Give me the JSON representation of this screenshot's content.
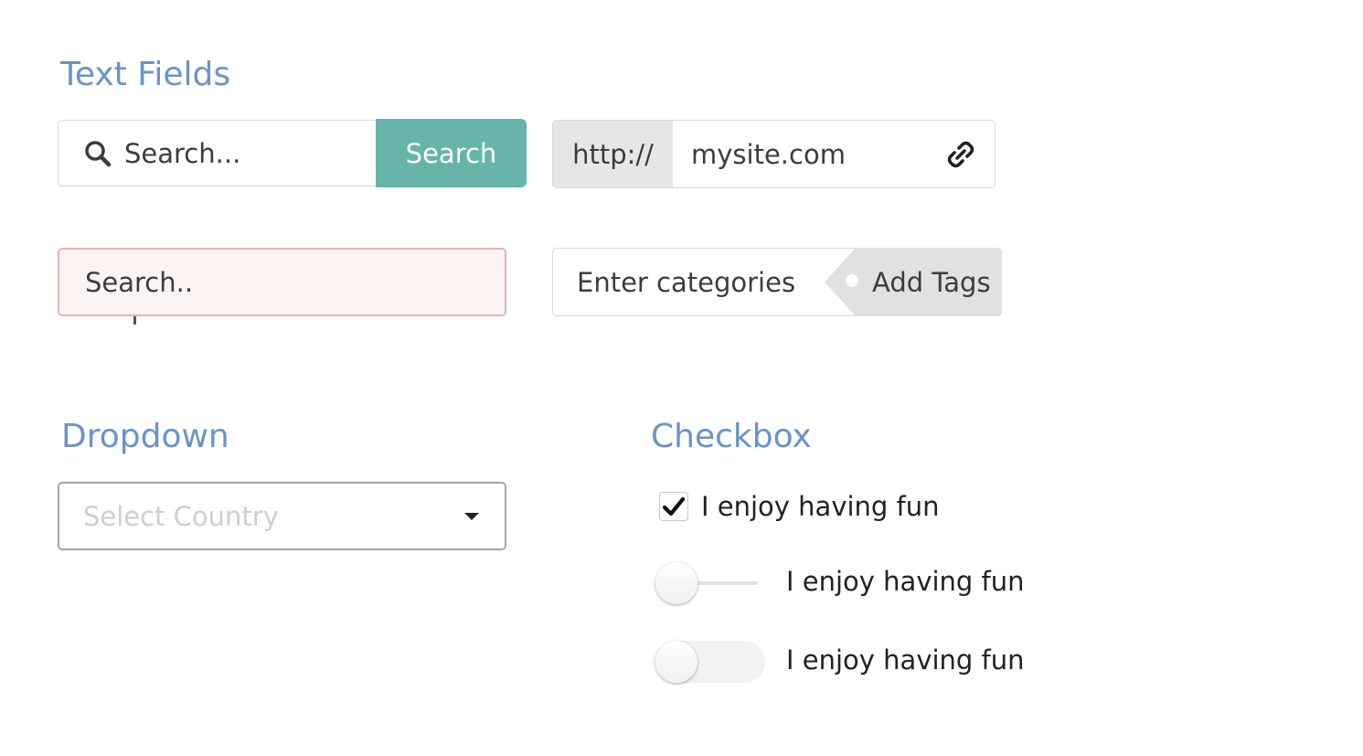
{
  "sections": {
    "text_fields": "Text Fields",
    "dropdown": "Dropdown",
    "checkbox": "Checkbox"
  },
  "search": {
    "placeholder": "Search...",
    "button_label": "Search",
    "icon": "search-icon"
  },
  "url": {
    "prefix": "http://",
    "value": "mysite.com",
    "icon": "link-icon"
  },
  "error_field": {
    "placeholder": "Search.."
  },
  "tags": {
    "placeholder": "Enter categories",
    "button_label": "Add Tags"
  },
  "select": {
    "placeholder": "Select Country"
  },
  "checkboxes": {
    "checkbox_label": "I enjoy having fun",
    "checkbox_checked": true,
    "slider_label": "I enjoy having fun",
    "slider_on": false,
    "toggle_label": "I enjoy having fun",
    "toggle_on": false
  },
  "colors": {
    "heading": "#6b93c6",
    "accent": "#66b5a8",
    "error_border": "#e4b3b8",
    "error_bg": "#fbf4f3"
  }
}
